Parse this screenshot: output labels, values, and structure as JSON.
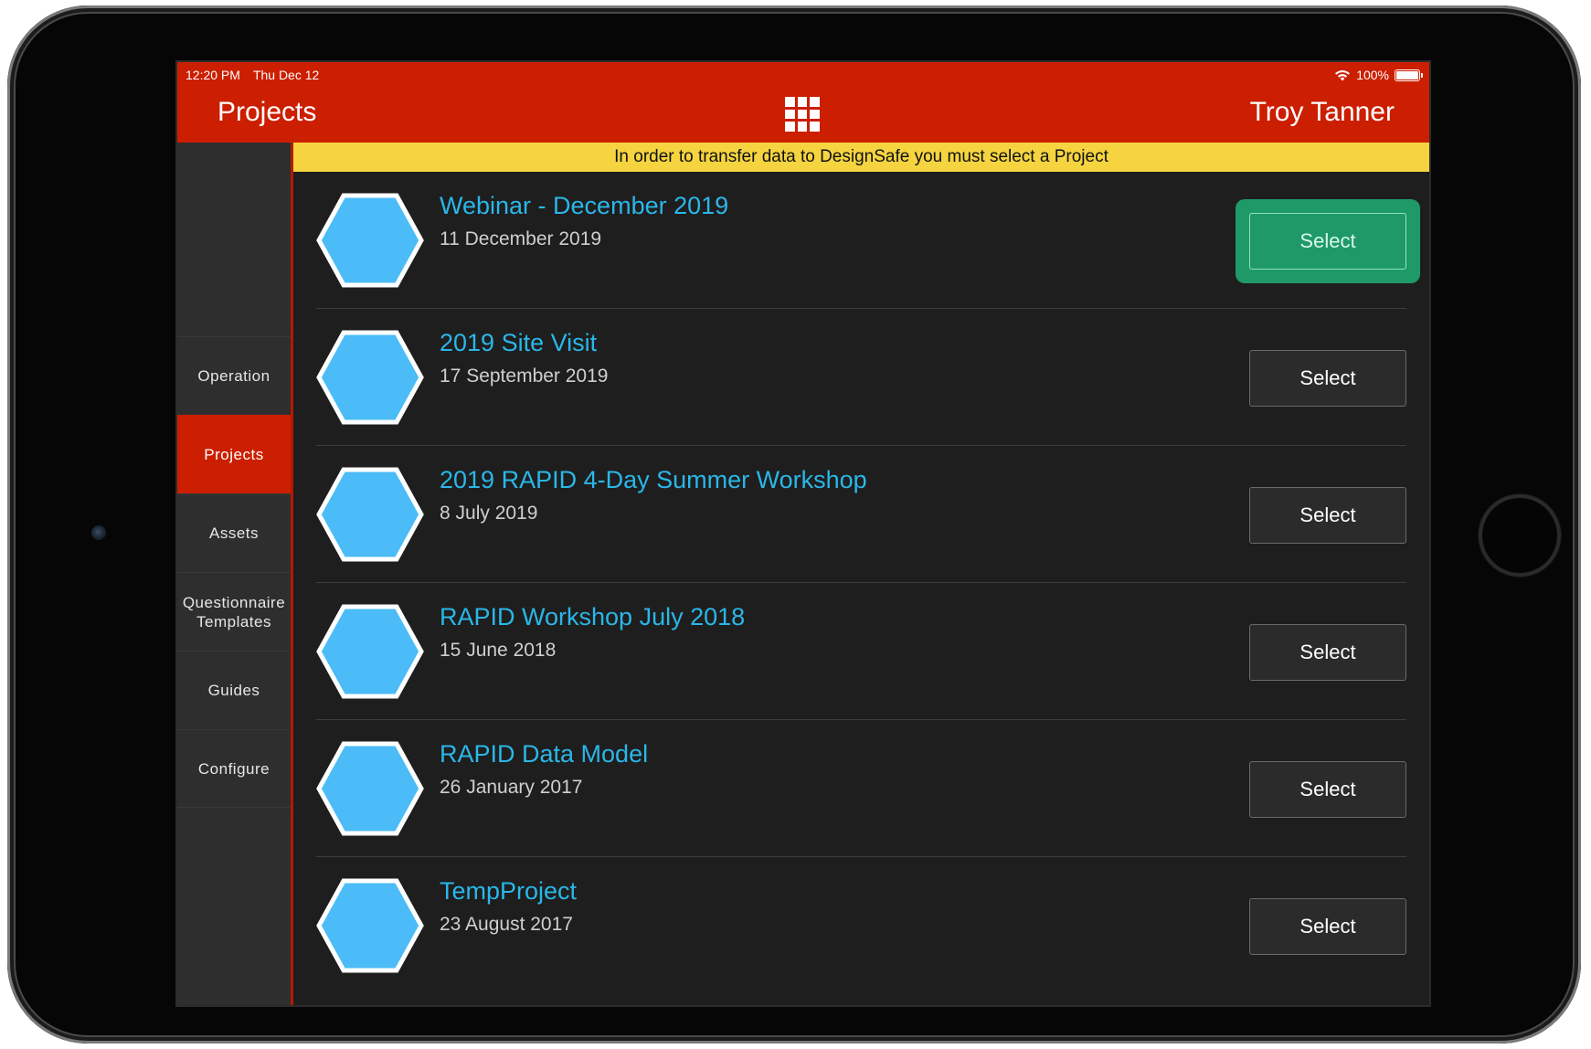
{
  "status_bar": {
    "time": "12:20 PM",
    "date": "Thu Dec 12",
    "battery": "100%"
  },
  "header": {
    "title": "Projects",
    "apps_icon": "grid-icon",
    "user": "Troy Tanner"
  },
  "sidebar": {
    "items": [
      {
        "label": "Operation",
        "active": false
      },
      {
        "label": "Projects",
        "active": true
      },
      {
        "label": "Assets",
        "active": false
      },
      {
        "label": "Questionnaire Templates",
        "active": false
      },
      {
        "label": "Guides",
        "active": false
      },
      {
        "label": "Configure",
        "active": false
      }
    ]
  },
  "banner": {
    "text": "In order to transfer data to DesignSafe you must select a Project"
  },
  "projects": [
    {
      "title": "Webinar - December 2019",
      "date": "11 December 2019",
      "button": "Select",
      "selected": true
    },
    {
      "title": "2019 Site Visit",
      "date": "17 September 2019",
      "button": "Select",
      "selected": false
    },
    {
      "title": "2019 RAPID 4-Day Summer Workshop",
      "date": "8 July 2019",
      "button": "Select",
      "selected": false
    },
    {
      "title": "RAPID Workshop July 2018",
      "date": "15 June 2018",
      "button": "Select",
      "selected": false
    },
    {
      "title": "RAPID Data Model",
      "date": "26 January 2017",
      "button": "Select",
      "selected": false
    },
    {
      "title": "TempProject",
      "date": "23 August 2017",
      "button": "Select",
      "selected": false
    }
  ],
  "colors": {
    "header_red": "#cc1e00",
    "banner_yellow": "#f5d440",
    "title_blue": "#2ab7e8",
    "hexagon_blue": "#4bbcf7",
    "selected_green": "#1f9968"
  }
}
